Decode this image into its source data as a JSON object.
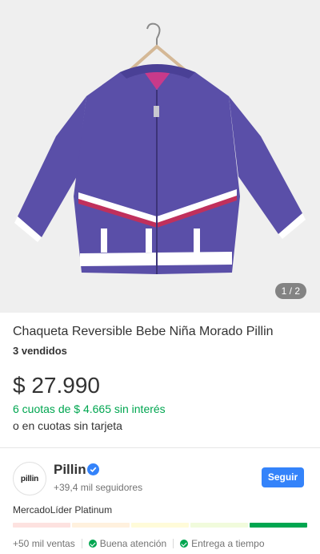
{
  "product": {
    "image_counter": "1 / 2",
    "title": "Chaqueta Reversible Bebe Niña Morado Pillin",
    "sold": "3 vendidos",
    "price": "$ 27.990",
    "installments": "6 cuotas de $ 4.665 sin interés",
    "no_card": "o en cuotas sin tarjeta",
    "image_icon": "purple-reversible-jacket-on-hanger"
  },
  "seller": {
    "avatar_text": "pillin",
    "name": "Pillin",
    "verified_icon": "verified-check-icon",
    "followers": "+39,4 mil seguidores",
    "follow_label": "Seguir",
    "reputation": "MercadoLíder Platinum",
    "thermometer_colors": [
      "#fde2e0",
      "#fff1de",
      "#fffbd9",
      "#f1fbdc",
      "#00a650"
    ],
    "stats": {
      "sales": "+50 mil ventas",
      "service": "Buena atención",
      "delivery": "Entrega a tiempo"
    }
  },
  "colors": {
    "accent": "#3483fa",
    "success": "#00a650",
    "jacket": "#5a4fa8"
  }
}
